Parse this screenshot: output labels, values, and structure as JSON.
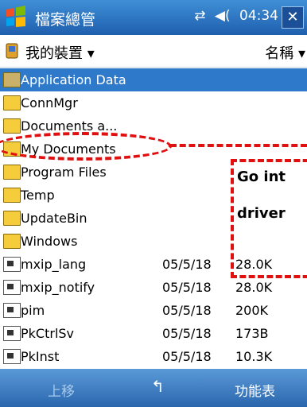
{
  "window": {
    "title": "檔案總管",
    "time": "04:34",
    "connectivity_icon": "antenna-icon",
    "volume_icon": "speaker-icon"
  },
  "location": {
    "current": "我的裝置",
    "sort": "名稱"
  },
  "files": [
    {
      "name": "Application Data",
      "type": "folder",
      "date": "",
      "size": "",
      "selected": true
    },
    {
      "name": "ConnMgr",
      "type": "folder",
      "date": "",
      "size": ""
    },
    {
      "name": "Documents a...",
      "type": "folder",
      "date": "",
      "size": ""
    },
    {
      "name": "My Documents",
      "type": "folder",
      "date": "",
      "size": ""
    },
    {
      "name": "Program Files",
      "type": "folder",
      "date": "",
      "size": ""
    },
    {
      "name": "Temp",
      "type": "folder",
      "date": "",
      "size": ""
    },
    {
      "name": "UpdateBin",
      "type": "folder",
      "date": "",
      "size": ""
    },
    {
      "name": "Windows",
      "type": "folder",
      "date": "",
      "size": ""
    },
    {
      "name": "mxip_lang",
      "type": "file",
      "date": "05/5/18",
      "size": "28.0K"
    },
    {
      "name": "mxip_notify",
      "type": "file",
      "date": "05/5/18",
      "size": "28.0K"
    },
    {
      "name": "pim",
      "type": "file",
      "date": "05/5/18",
      "size": "200K"
    },
    {
      "name": "PkCtrlSv",
      "type": "file",
      "date": "05/5/18",
      "size": "173B"
    },
    {
      "name": "PkInst",
      "type": "file",
      "date": "05/5/18",
      "size": "10.3K"
    }
  ],
  "annotation": {
    "line1": "Go int",
    "line2": "driver"
  },
  "softkeys": {
    "left": "上移",
    "middle": "↰",
    "right": "功能表"
  },
  "colors": {
    "titlebar": "#2f77c6",
    "selection": "#2e79c9",
    "annotation": "#e01010"
  }
}
